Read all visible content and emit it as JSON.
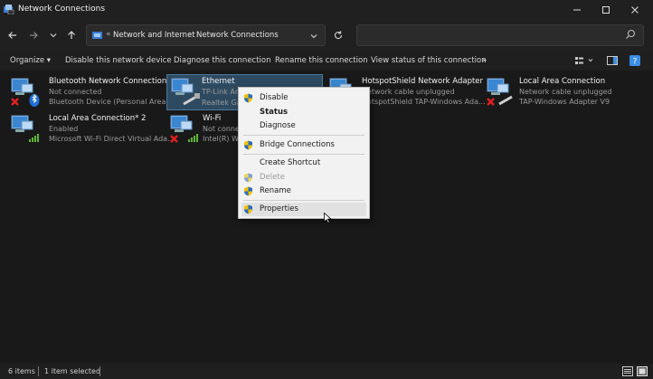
{
  "window": {
    "title": "Network Connections"
  },
  "address": {
    "crumbs": [
      "Network and Internet",
      "Network Connections"
    ]
  },
  "commands": {
    "organize": "Organize",
    "disable": "Disable this network device",
    "diagnose": "Diagnose this connection",
    "rename": "Rename this connection",
    "view_status": "View status of this connection",
    "more": "»"
  },
  "items": [
    {
      "name": "Bluetooth Network Connection",
      "line1": "Not connected",
      "line2": "Bluetooth Device (Personal Area ..."
    },
    {
      "name": "Ethernet",
      "line1": "TP-Link Ar",
      "line2": "Realtek Ga"
    },
    {
      "name": "HotspotShield Network Adapter",
      "line1": "Network cable unplugged",
      "line2": "HotspotShield TAP-Windows Ada..."
    },
    {
      "name": "Local Area Connection",
      "line1": "Network cable unplugged",
      "line2": "TAP-Windows Adapter V9"
    },
    {
      "name": "Local Area Connection* 2",
      "line1": "Enabled",
      "line2": "Microsoft Wi-Fi Direct Virtual Ada..."
    },
    {
      "name": "Wi-Fi",
      "line1": "Not conne",
      "line2": "Intel(R) W"
    }
  ],
  "context_menu": [
    {
      "label": "Disable",
      "shield": true
    },
    {
      "label": "Status",
      "bold": true
    },
    {
      "label": "Diagnose"
    },
    {
      "label": "Bridge Connections",
      "shield": true
    },
    {
      "label": "Create Shortcut"
    },
    {
      "label": "Delete",
      "shield": true,
      "disabled": true
    },
    {
      "label": "Rename",
      "shield": true
    },
    {
      "label": "Properties",
      "shield": true,
      "hover": true
    }
  ],
  "status": {
    "count": "6 items",
    "selected": "1 item selected"
  },
  "colors": {
    "background": "#191919",
    "selection": "#2e4a61",
    "menu": "#f2f2f2",
    "accent": "#3a8ee6"
  }
}
